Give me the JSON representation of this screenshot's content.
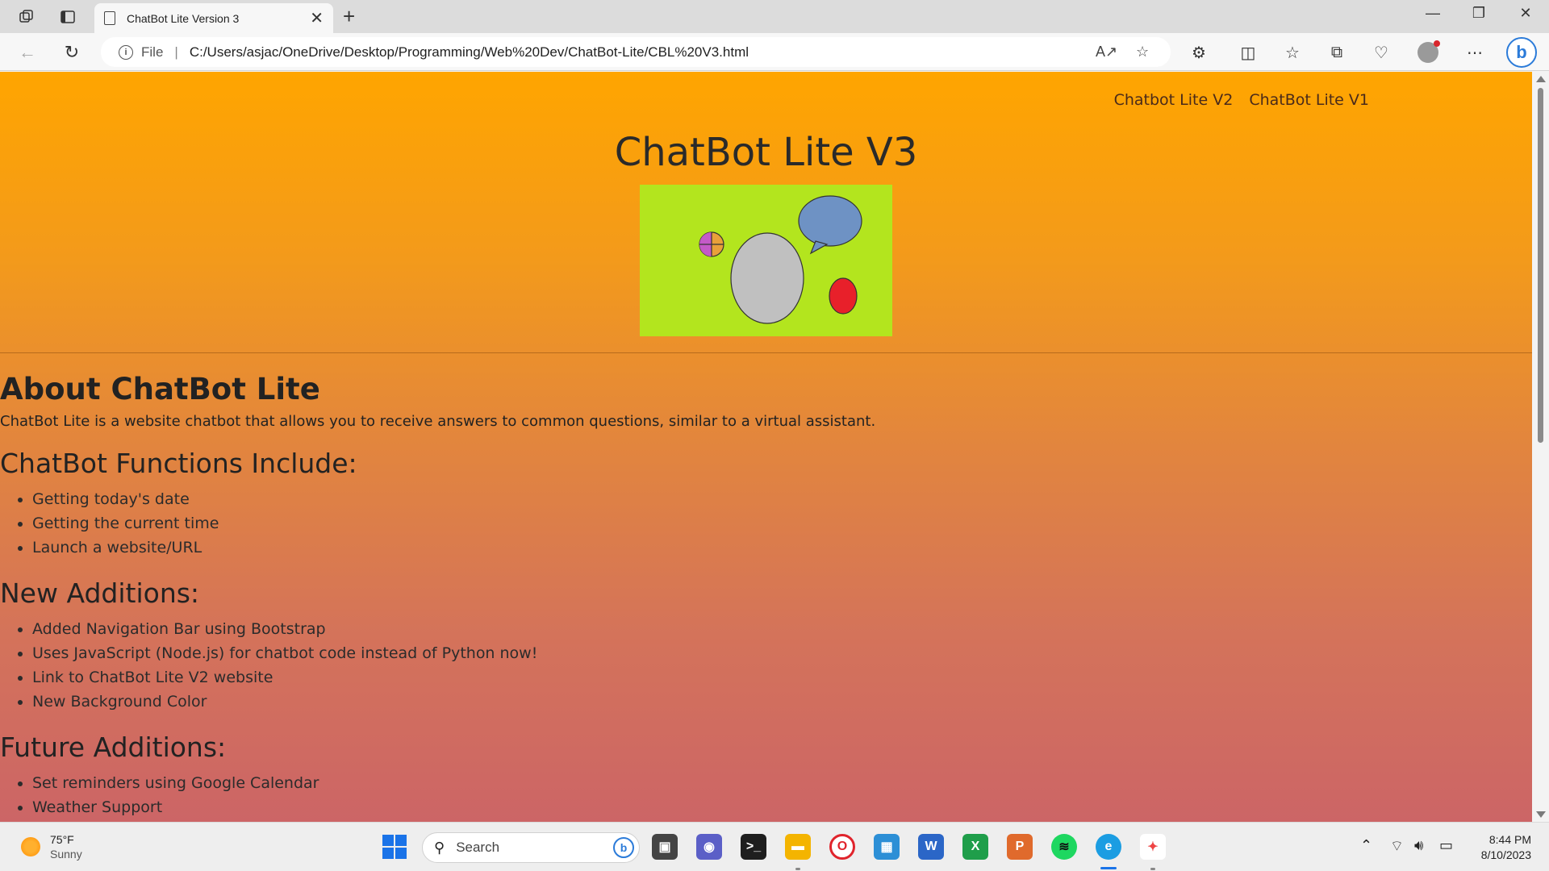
{
  "browser": {
    "tab_title": "ChatBot Lite Version 3",
    "url_scheme_label": "File",
    "url": "C:/Users/asjac/OneDrive/Desktop/Programming/Web%20Dev/ChatBot-Lite/CBL%20V3.html"
  },
  "site": {
    "nav_links": [
      "Chatbot Lite V2",
      "ChatBot Lite V1"
    ],
    "title": "ChatBot Lite V3"
  },
  "content": {
    "about_heading": "About ChatBot Lite",
    "about_text": "ChatBot Lite is a website chatbot that allows you to receive answers to common questions, similar to a virtual assistant.",
    "functions_heading": "ChatBot Functions Include:",
    "functions": [
      "Getting today's date",
      "Getting the current time",
      "Launch a website/URL"
    ],
    "additions_heading": "New Additions:",
    "additions": [
      "Added Navigation Bar using Bootstrap",
      "Uses JavaScript (Node.js) for chatbot code instead of Python now!",
      "Link to ChatBot Lite V2 website",
      "New Background Color"
    ],
    "future_heading": "Future Additions:",
    "future": [
      "Set reminders using Google Calendar",
      "Weather Support"
    ]
  },
  "taskbar": {
    "weather_temp": "75°F",
    "weather_cond": "Sunny",
    "search_placeholder": "Search",
    "time": "8:44 PM",
    "date": "8/10/2023"
  },
  "colors": {
    "page_gradient_top": "#ffa500",
    "page_gradient_bottom": "#cc6566",
    "logo_bg": "#b3e51e",
    "bubble": "#6e92c4",
    "oval": "#c0c0c0",
    "red_oval": "#e8202a"
  }
}
